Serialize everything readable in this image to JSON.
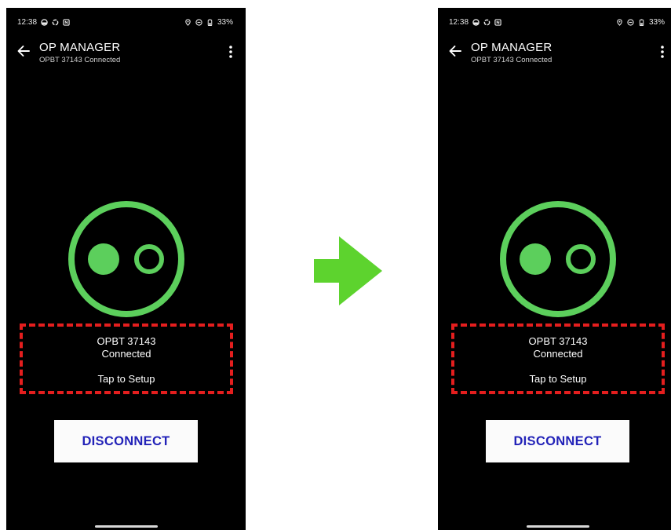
{
  "screens": [
    {
      "status_bar": {
        "time": "12:38",
        "battery": "33%"
      },
      "app_bar": {
        "title": "OP MANAGER",
        "subtitle": "OPBT 37143 Connected"
      },
      "device_info": {
        "name": "OPBT 37143",
        "state": "Connected",
        "action": "Tap to Setup"
      },
      "button": {
        "label": "DISCONNECT"
      }
    },
    {
      "status_bar": {
        "time": "12:38",
        "battery": "33%"
      },
      "app_bar": {
        "title": "OP MANAGER",
        "subtitle": "OPBT 37143 Connected"
      },
      "device_info": {
        "name": "OPBT 37143",
        "state": "Connected",
        "action": "Tap to Setup"
      },
      "button": {
        "label": "DISCONNECT"
      }
    }
  ],
  "icons": {
    "status_left": [
      "cloud-icon",
      "sync-icon",
      "nfc-icon"
    ],
    "status_right": [
      "location-icon",
      "do-not-disturb-icon",
      "battery-icon"
    ],
    "back": "back-arrow-icon",
    "menu": "overflow-menu-icon",
    "device_status": "connection-status-icon",
    "transition": "right-arrow-icon"
  },
  "colors": {
    "screen_background": "#000000",
    "status_green": "#5ccf5c",
    "highlight_border": "#e41e1e",
    "button_text": "#2222b8",
    "button_background": "#fbfbfb",
    "arrow_green": "#5dd32e"
  }
}
